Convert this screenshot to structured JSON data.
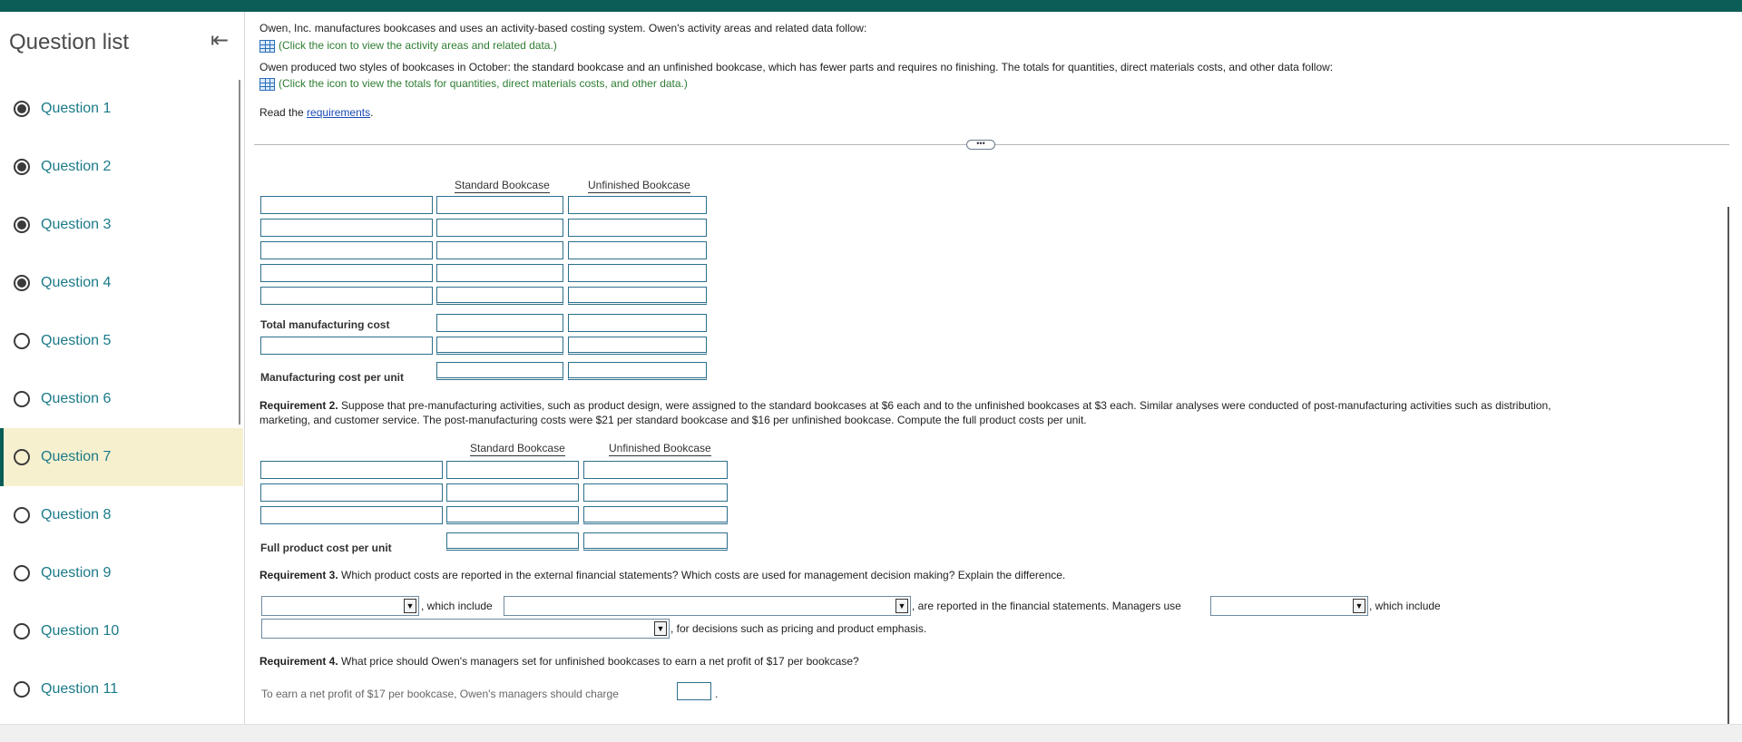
{
  "sidebar": {
    "title": "Question list",
    "questions": [
      {
        "label": "Question 1",
        "state": "answered"
      },
      {
        "label": "Question 2",
        "state": "answered"
      },
      {
        "label": "Question 3",
        "state": "answered"
      },
      {
        "label": "Question 4",
        "state": "answered"
      },
      {
        "label": "Question 5",
        "state": "unanswered"
      },
      {
        "label": "Question 6",
        "state": "unanswered"
      },
      {
        "label": "Question 7",
        "state": "current"
      },
      {
        "label": "Question 8",
        "state": "unanswered"
      },
      {
        "label": "Question 9",
        "state": "unanswered"
      },
      {
        "label": "Question 10",
        "state": "unanswered"
      },
      {
        "label": "Question 11",
        "state": "unanswered"
      }
    ]
  },
  "problem": {
    "intro1": "Owen, Inc. manufactures bookcases and uses an activity-based costing system. Owen's activity areas and related data follow:",
    "link1": "(Click the icon to view the activity areas and related data.)",
    "intro2": "Owen produced two styles of bookcases in October: the standard bookcase and an unfinished bookcase, which has fewer parts and requires no finishing. The totals for quantities, direct materials costs, and other data follow:",
    "link2": "(Click the icon to view the totals for quantities, direct materials costs, and other data.)",
    "read_prefix": "Read the ",
    "read_link": "requirements",
    "read_suffix": "."
  },
  "table1": {
    "col1": "Standard Bookcase",
    "col2": "Unfinished Bookcase",
    "total_label": "Total manufacturing cost",
    "per_unit_label": "Manufacturing cost per unit"
  },
  "req2": {
    "title": "Requirement 2.",
    "text_line1": "Suppose that pre-manufacturing activities, such as product design, were assigned to the standard bookcases at $6 each and to the unfinished bookcases at $3 each. Similar analyses were conducted of post-manufacturing activities such as distribution,",
    "text_line2": "marketing, and customer service. The post-manufacturing costs were $21 per standard bookcase and $16 per unfinished bookcase. Compute the full product costs per unit.",
    "col1": "Standard Bookcase",
    "col2": "Unfinished Bookcase",
    "full_label": "Full product cost per unit"
  },
  "req3": {
    "title": "Requirement 3.",
    "text": "Which product costs are reported in the external financial statements? Which costs are used for management decision making? Explain the difference.",
    "t1": ", which include",
    "t2": ", are reported in the financial statements. Managers use",
    "t3": ", which include",
    "t4": ", for decisions such as pricing and product emphasis."
  },
  "req4": {
    "title": "Requirement 4.",
    "text": "What price should Owen's managers set for unfinished bookcases to earn a net profit of $17 per bookcase?",
    "answer_prefix": "To earn a net profit of $17 per bookcase, Owen's managers should charge",
    "answer_suffix": "."
  },
  "ui": {
    "divider_glyph": "•••",
    "dropdown_glyph": "▼",
    "collapse_glyph": "⇤"
  }
}
